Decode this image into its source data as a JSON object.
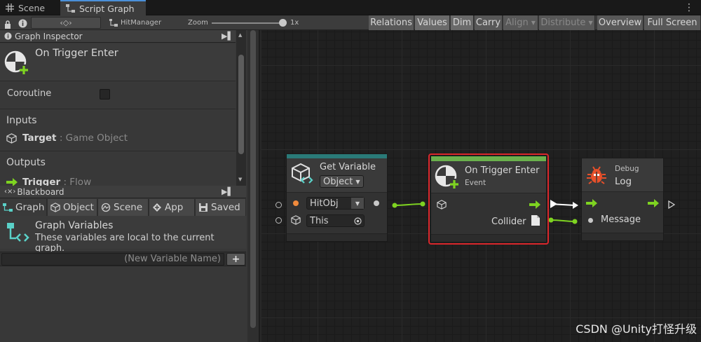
{
  "tabs": [
    {
      "label": "Scene",
      "icon": "grid-icon"
    },
    {
      "label": "Script Graph",
      "icon": "graph-icon"
    }
  ],
  "toolbar": {
    "breadcrumb": "HitManager",
    "zoom_label": "Zoom",
    "zoom_value": "1x",
    "zoom_fraction": 1.0,
    "buttons": [
      "Relations",
      "Values",
      "Dim",
      "Carry",
      "Align",
      "Distribute",
      "Overview",
      "Full Screen"
    ],
    "disabled": [
      "Align",
      "Distribute"
    ]
  },
  "inspector": {
    "title": "Graph Inspector",
    "node_title": "On Trigger Enter",
    "coroutine_label": "Coroutine",
    "inputs_label": "Inputs",
    "input_name": "Target",
    "input_type": ": Game Object",
    "outputs_label": "Outputs",
    "output_name": "Trigger",
    "output_type": ": Flow"
  },
  "blackboard": {
    "title": "Blackboard",
    "tabs": [
      "Graph",
      "Object",
      "Scene",
      "App",
      "Saved"
    ],
    "section_title": "Graph Variables",
    "section_desc": "These variables are local to the current graph.",
    "new_var_placeholder": "(New Variable Name)",
    "add_label": "+"
  },
  "nodes": {
    "get_variable": {
      "title": "Get Variable",
      "kind": "Object",
      "name_value": "HitObj",
      "target_value": "This"
    },
    "trigger_enter": {
      "title": "On Trigger Enter",
      "subtitle": "Event",
      "output_label": "Collider"
    },
    "debug_log": {
      "category": "Debug",
      "title": "Log",
      "input_label": "Message"
    }
  },
  "watermark": "CSDN @Unity打怪升级",
  "colors": {
    "accent_green": "#7ed321",
    "selection_red": "#d9262b",
    "get_var_bar": "#2a7a78",
    "event_bar": "#6ab04c"
  }
}
